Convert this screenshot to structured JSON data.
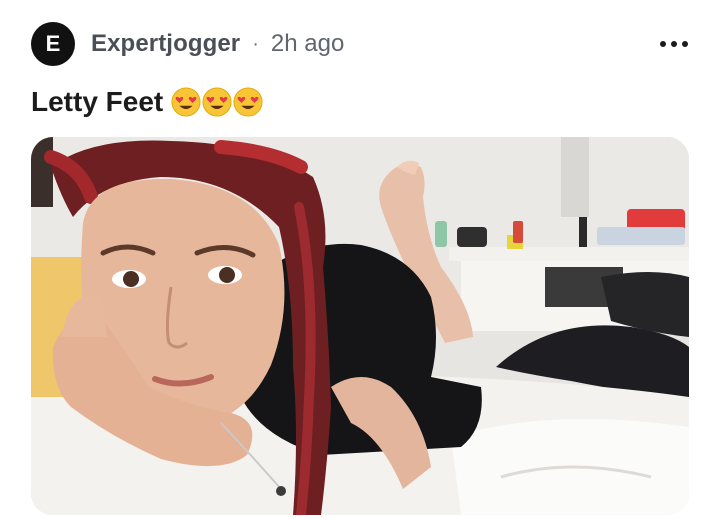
{
  "post": {
    "avatar_letter": "E",
    "author": "Expertjogger",
    "separator": "·",
    "time": "2h ago",
    "title": "Letty Feet",
    "title_emojis": [
      "heart-eyes-emoji",
      "heart-eyes-emoji",
      "heart-eyes-emoji"
    ]
  },
  "colors": {
    "avatar_bg": "#111111",
    "author_text": "#4a4f57",
    "meta_text": "#5f6670",
    "title_text": "#1c1c1c",
    "emoji_face": "#f8c537",
    "emoji_heart": "#e8364b"
  },
  "icons": {
    "more": "more-options-icon"
  }
}
